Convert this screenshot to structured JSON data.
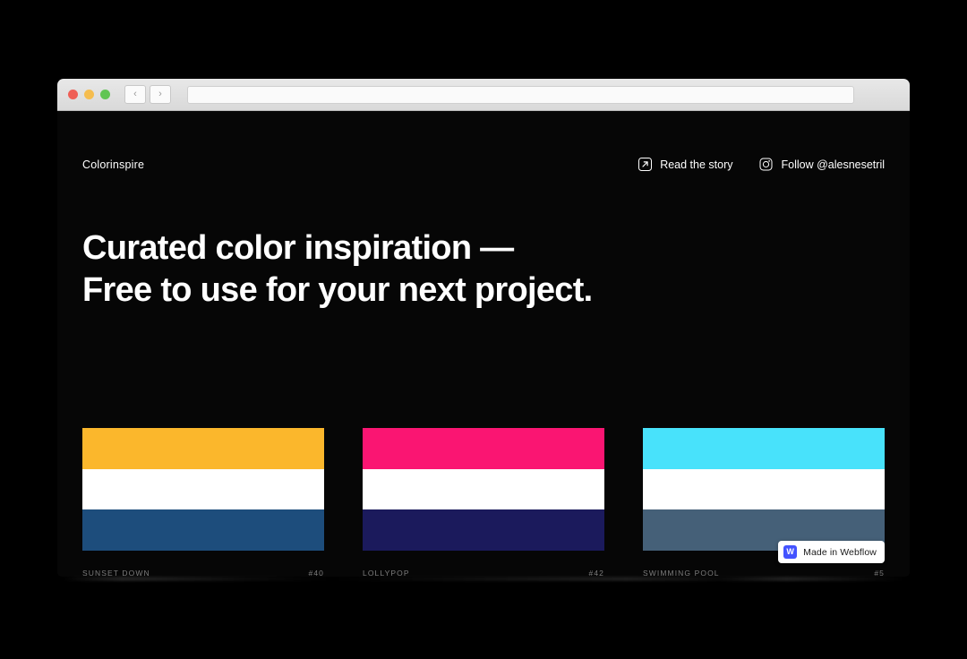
{
  "browser": {
    "traffic_lights": [
      "close",
      "minimize",
      "maximize"
    ],
    "back_label": "‹",
    "forward_label": "›",
    "url_value": "",
    "url_placeholder": ""
  },
  "site": {
    "brand": "Colorinspire",
    "header_links": [
      {
        "label": "Read the story",
        "icon": "external-link-icon"
      },
      {
        "label": "Follow @alesnesetril",
        "icon": "instagram-icon"
      }
    ],
    "headline": "Curated color inspiration —\nFree to use for your next project."
  },
  "palettes": [
    {
      "name": "SUNSET DOWN",
      "number": "#40",
      "colors": [
        "#FBB72C",
        "#FFFFFF",
        "#1D4D7C"
      ]
    },
    {
      "name": "LOLLYPOP",
      "number": "#42",
      "colors": [
        "#FA1572",
        "#FFFFFF",
        "#1B1A5C"
      ]
    },
    {
      "name": "SWIMMING POOL",
      "number": "#5",
      "colors": [
        "#48E2FB",
        "#FFFFFF",
        "#456078"
      ]
    }
  ],
  "webflow_badge": {
    "mark": "W",
    "label": "Made in Webflow",
    "brand_color": "#4353FF"
  },
  "theme": {
    "page_background": "#000000",
    "text_color": "#FFFFFF",
    "muted_text_color": "#7D7D7D"
  }
}
